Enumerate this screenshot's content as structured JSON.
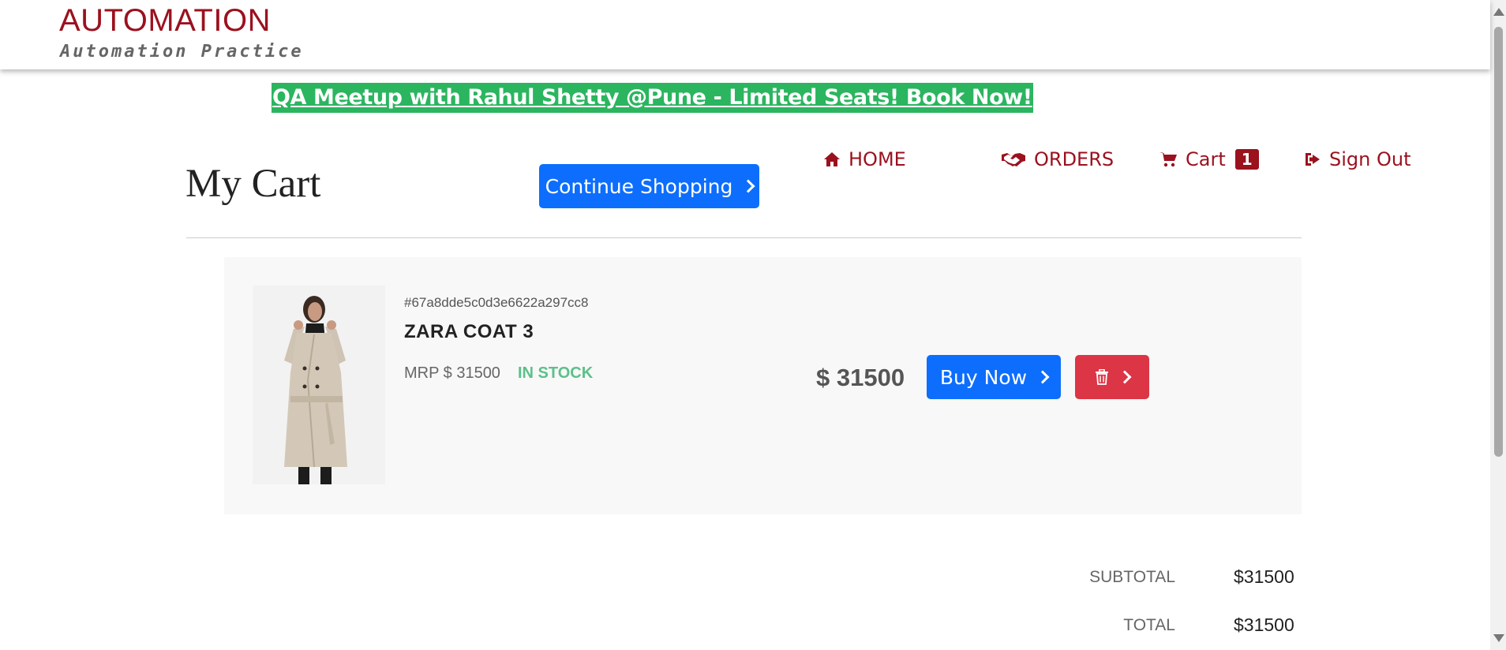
{
  "header": {
    "logo_title": "AUTOMATION",
    "logo_subtitle": "Automation Practice"
  },
  "banner": {
    "text": "QA Meetup with Rahul Shetty @Pune - Limited Seats! Book Now!"
  },
  "page": {
    "title": "My Cart",
    "continue_label": "Continue Shopping"
  },
  "nav": {
    "home": "HOME",
    "orders": "ORDERS",
    "cart": "Cart",
    "cart_count": "1",
    "signout": "Sign Out"
  },
  "item": {
    "id": "#67a8dde5c0d3e6622a297cc8",
    "name": "ZARA COAT 3",
    "mrp": "MRP $ 31500",
    "stock": "IN STOCK",
    "price": "$ 31500",
    "buy_label": "Buy Now",
    "image_icon": "product-photo-coat"
  },
  "summary": {
    "subtotal_label": "SUBTOTAL",
    "subtotal_value": "$31500",
    "total_label": "TOTAL",
    "total_value": "$31500"
  },
  "colors": {
    "brand": "#9b111e",
    "primary": "#0d6efd",
    "danger": "#dc3545",
    "banner": "#2bb55f",
    "in_stock": "#5cc08a"
  }
}
